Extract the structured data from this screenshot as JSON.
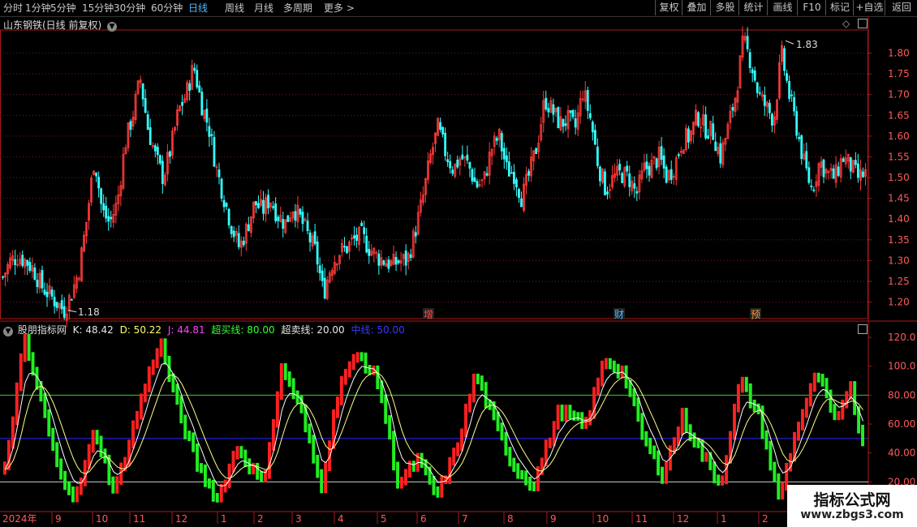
{
  "toolbar": {
    "timeframes": [
      "分时",
      "1分钟",
      "5分钟",
      "15分钟",
      "30分钟",
      "60分钟",
      "日线",
      "周线",
      "月线",
      "多周期",
      "更多 >"
    ],
    "active_timeframe": "日线",
    "right_buttons": [
      "复权",
      "叠加",
      "多股",
      "统计",
      "画线",
      "F10",
      "标记",
      "+自选",
      "返回"
    ]
  },
  "main_panel": {
    "title": "山东钢铁(日线 前复权)",
    "high_label": "1.83",
    "low_label": "1.18",
    "event_markers": [
      {
        "text": "增",
        "color": "#ff4a4a"
      },
      {
        "text": "财",
        "color": "#4fb9ff"
      },
      {
        "text": "预",
        "color": "#ff9933"
      }
    ],
    "price_ticks": [
      "1.80",
      "1.75",
      "1.70",
      "1.65",
      "1.60",
      "1.55",
      "1.50",
      "1.45",
      "1.40",
      "1.35",
      "1.30",
      "1.25",
      "1.20"
    ]
  },
  "indicator_panel": {
    "name": "股朋指标网",
    "values": [
      {
        "label": "K: 48.42",
        "color": "#e8e8e8"
      },
      {
        "label": "D: 50.22",
        "color": "#ffff66"
      },
      {
        "label": "J: 44.81",
        "color": "#ff44ff"
      },
      {
        "label": "超买线: 80.00",
        "color": "#33ff33"
      },
      {
        "label": "超卖线: 20.00",
        "color": "#e8e8e8"
      },
      {
        "label": "中线: 50.00",
        "color": "#3a3aff"
      }
    ],
    "ticks": [
      "120.0",
      "100.0",
      "80.00",
      "60.00",
      "40.00",
      "20.00"
    ],
    "overbought": 80,
    "oversold": 20,
    "midline": 50
  },
  "x_axis": {
    "year_label": "2024年",
    "months": [
      "9",
      "10",
      "11",
      "12",
      "1",
      "2",
      "3",
      "4",
      "5",
      "6",
      "7",
      "8",
      "9",
      "10",
      "11",
      "12",
      "1",
      "2"
    ]
  },
  "watermark": {
    "line1": "指标公式网",
    "line2": "www.zbgs3.com"
  },
  "colors": {
    "up": "#ff3a3a",
    "down": "#33ffff",
    "grid": "#7a1a1a",
    "border": "#aa1a1a",
    "kdj_up": "#ff2020",
    "kdj_down": "#22ee22"
  },
  "chart_data": {
    "type": "candlestick",
    "price_range": [
      1.16,
      1.85
    ],
    "key_prices": [
      1.26,
      1.3,
      1.31,
      1.3,
      1.28,
      1.24,
      1.22,
      1.2,
      1.18,
      1.22,
      1.28,
      1.4,
      1.55,
      1.42,
      1.39,
      1.44,
      1.58,
      1.65,
      1.74,
      1.62,
      1.55,
      1.5,
      1.57,
      1.66,
      1.7,
      1.77,
      1.68,
      1.62,
      1.52,
      1.45,
      1.38,
      1.33,
      1.38,
      1.44,
      1.42,
      1.45,
      1.41,
      1.39,
      1.43,
      1.4,
      1.36,
      1.32,
      1.22,
      1.29,
      1.32,
      1.33,
      1.35,
      1.36,
      1.33,
      1.31,
      1.3,
      1.29,
      1.3,
      1.3,
      1.37,
      1.45,
      1.55,
      1.62,
      1.56,
      1.52,
      1.55,
      1.53,
      1.48,
      1.49,
      1.57,
      1.6,
      1.52,
      1.51,
      1.45,
      1.51,
      1.58,
      1.69,
      1.66,
      1.63,
      1.64,
      1.62,
      1.71,
      1.64,
      1.53,
      1.47,
      1.5,
      1.51,
      1.5,
      1.46,
      1.52,
      1.53,
      1.55,
      1.5,
      1.53,
      1.59,
      1.6,
      1.65,
      1.62,
      1.61,
      1.55,
      1.62,
      1.7,
      1.83,
      1.78,
      1.7,
      1.67,
      1.64,
      1.8,
      1.7,
      1.62,
      1.53,
      1.47,
      1.54,
      1.51,
      1.5,
      1.55,
      1.53,
      1.5,
      1.51
    ],
    "kdj_swing_values": [
      [
        0,
        28
      ],
      [
        3,
        118
      ],
      [
        6,
        70
      ],
      [
        8,
        32
      ],
      [
        11,
        8
      ],
      [
        14,
        56
      ],
      [
        17,
        12
      ],
      [
        21,
        75
      ],
      [
        24,
        118
      ],
      [
        27,
        68
      ],
      [
        30,
        30
      ],
      [
        33,
        8
      ],
      [
        36,
        44
      ],
      [
        40,
        18
      ],
      [
        43,
        100
      ],
      [
        46,
        68
      ],
      [
        49,
        16
      ],
      [
        52,
        90
      ],
      [
        55,
        108
      ],
      [
        58,
        88
      ],
      [
        61,
        18
      ],
      [
        64,
        35
      ],
      [
        67,
        10
      ],
      [
        70,
        42
      ],
      [
        73,
        95
      ],
      [
        76,
        60
      ],
      [
        79,
        30
      ],
      [
        82,
        18
      ],
      [
        86,
        70
      ],
      [
        90,
        58
      ],
      [
        93,
        105
      ],
      [
        96,
        95
      ],
      [
        99,
        50
      ],
      [
        102,
        25
      ],
      [
        105,
        65
      ],
      [
        108,
        40
      ],
      [
        111,
        18
      ],
      [
        114,
        90
      ],
      [
        117,
        65
      ],
      [
        120,
        8
      ],
      [
        123,
        60
      ],
      [
        126,
        95
      ],
      [
        129,
        58
      ],
      [
        131,
        90
      ],
      [
        133,
        45
      ]
    ]
  }
}
